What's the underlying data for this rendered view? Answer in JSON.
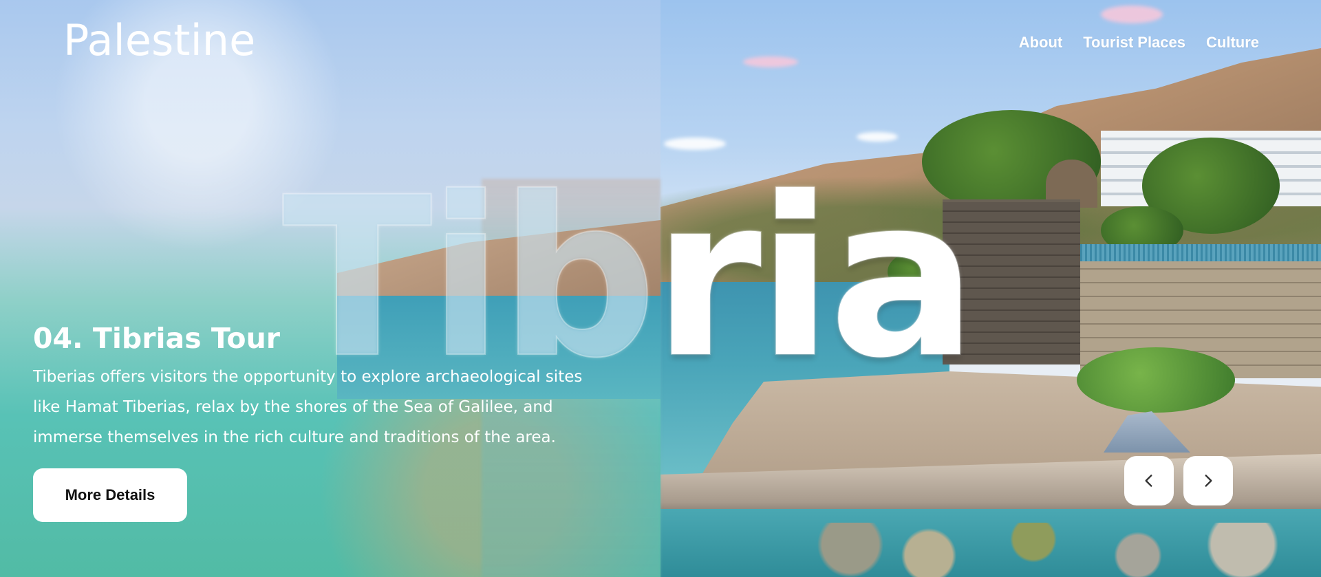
{
  "header": {
    "logo": "Palestine",
    "nav": [
      "About",
      "Tourist Places",
      "Culture"
    ]
  },
  "slide": {
    "big_word": "Tibria",
    "title": "04. Tibrias Tour",
    "description": "Tiberias offers visitors the opportunity to explore archaeological sites like Hamat Tiberias, relax by the shores of the Sea of Galilee, and immerse themselves in the rich culture and traditions of the area.",
    "button_label": "More Details"
  },
  "controls": {
    "prev_icon": "chevron-left-icon",
    "next_icon": "chevron-right-icon"
  }
}
